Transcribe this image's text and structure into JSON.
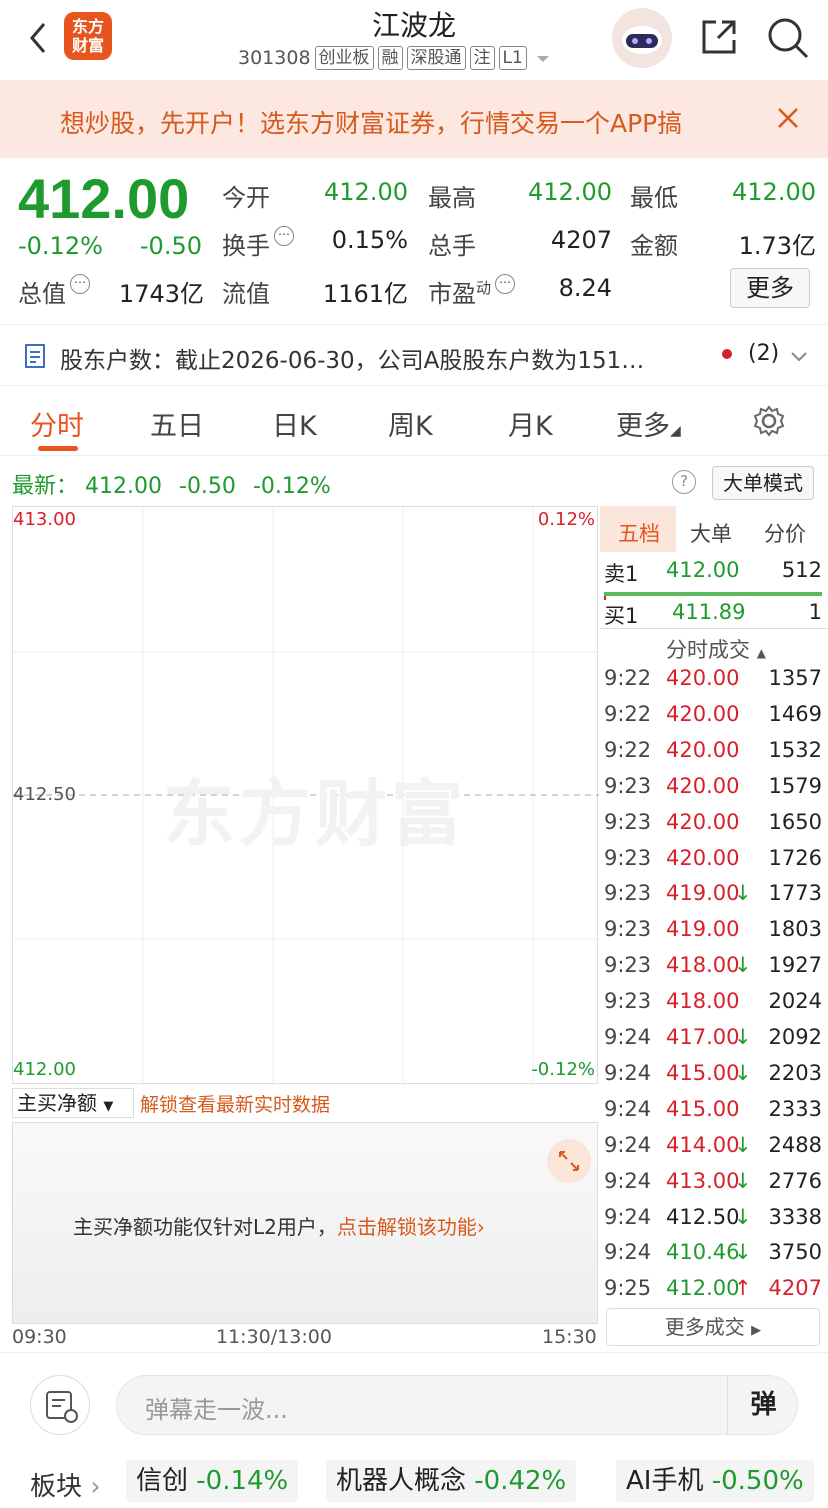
{
  "header": {
    "logo_line1": "东方",
    "logo_line2": "财富",
    "title": "江波龙",
    "code": "301308",
    "tags": [
      "创业板",
      "融",
      "深股通",
      "注",
      "L1"
    ]
  },
  "banner": {
    "text": "想炒股，先开户！选东方财富证券，行情交易一个APP搞"
  },
  "quote": {
    "price": "412.00",
    "change_pct": "-0.12%",
    "change": "-0.50",
    "open_label": "今开",
    "open": "412.00",
    "high_label": "最高",
    "high": "412.00",
    "low_label": "最低",
    "low": "412.00",
    "turnover_label": "换手",
    "turnover": "0.15%",
    "volume_label": "总手",
    "volume": "4207",
    "amount_label": "金额",
    "amount": "1.73亿",
    "mktcap_label": "总值",
    "mktcap": "1743亿",
    "float_label": "流值",
    "float": "1161亿",
    "pe_label": "市盈",
    "pe_sup": "动",
    "pe": "8.24",
    "more": "更多"
  },
  "notice": {
    "text": "股东户数：截止2026-06-30，公司A股股东户数为151…",
    "count": "(2)"
  },
  "tabs": [
    "分时",
    "五日",
    "日K",
    "周K",
    "月K",
    "更多"
  ],
  "latest": {
    "label": "最新：",
    "price": "412.00",
    "change": "-0.50",
    "pct": "-0.12%",
    "help": "?",
    "big_order_mode": "大单模式"
  },
  "chart": {
    "y_high": "413.00",
    "y_mid": "412.50",
    "y_low": "412.00",
    "pct_high": "0.12%",
    "pct_low": "-0.12%",
    "watermark": "东方财富",
    "time_start": "09:30",
    "time_mid": "11:30/13:00",
    "time_end": "15:30"
  },
  "orderbook": {
    "tabs": [
      "五档",
      "大单",
      "分价"
    ],
    "sell1": {
      "label": "卖1",
      "price": "412.00",
      "vol": "512"
    },
    "buy1": {
      "label": "买1",
      "price": "411.89",
      "vol": "1"
    },
    "trades_header": "分时成交",
    "trades": [
      {
        "t": "9:22",
        "p": "420.00",
        "v": "1357",
        "pc": "red",
        "vc": "black",
        "arrow": ""
      },
      {
        "t": "9:22",
        "p": "420.00",
        "v": "1469",
        "pc": "red",
        "vc": "black",
        "arrow": ""
      },
      {
        "t": "9:22",
        "p": "420.00",
        "v": "1532",
        "pc": "red",
        "vc": "black",
        "arrow": ""
      },
      {
        "t": "9:23",
        "p": "420.00",
        "v": "1579",
        "pc": "red",
        "vc": "black",
        "arrow": ""
      },
      {
        "t": "9:23",
        "p": "420.00",
        "v": "1650",
        "pc": "red",
        "vc": "black",
        "arrow": ""
      },
      {
        "t": "9:23",
        "p": "420.00",
        "v": "1726",
        "pc": "red",
        "vc": "black",
        "arrow": ""
      },
      {
        "t": "9:23",
        "p": "419.00",
        "v": "1773",
        "pc": "red",
        "vc": "black",
        "arrow": "down"
      },
      {
        "t": "9:23",
        "p": "419.00",
        "v": "1803",
        "pc": "red",
        "vc": "black",
        "arrow": ""
      },
      {
        "t": "9:23",
        "p": "418.00",
        "v": "1927",
        "pc": "red",
        "vc": "black",
        "arrow": "down"
      },
      {
        "t": "9:23",
        "p": "418.00",
        "v": "2024",
        "pc": "red",
        "vc": "black",
        "arrow": ""
      },
      {
        "t": "9:24",
        "p": "417.00",
        "v": "2092",
        "pc": "red",
        "vc": "black",
        "arrow": "down"
      },
      {
        "t": "9:24",
        "p": "415.00",
        "v": "2203",
        "pc": "red",
        "vc": "black",
        "arrow": "down"
      },
      {
        "t": "9:24",
        "p": "415.00",
        "v": "2333",
        "pc": "red",
        "vc": "black",
        "arrow": ""
      },
      {
        "t": "9:24",
        "p": "414.00",
        "v": "2488",
        "pc": "red",
        "vc": "black",
        "arrow": "down"
      },
      {
        "t": "9:24",
        "p": "413.00",
        "v": "2776",
        "pc": "red",
        "vc": "black",
        "arrow": "down"
      },
      {
        "t": "9:24",
        "p": "412.50",
        "v": "3338",
        "pc": "black",
        "vc": "black",
        "arrow": "down"
      },
      {
        "t": "9:24",
        "p": "410.46",
        "v": "3750",
        "pc": "green",
        "vc": "black",
        "arrow": "down"
      },
      {
        "t": "9:25",
        "p": "412.00",
        "v": "4207",
        "pc": "green",
        "vc": "red",
        "arrow": "up"
      }
    ],
    "more_trades": "更多成交"
  },
  "netbuy": {
    "selector": "主买净额",
    "unlock": "解锁查看最新实时数据",
    "message": "主买净额功能仅针对L2用户，",
    "message_link": "点击解锁该功能"
  },
  "comment": {
    "placeholder": "弹幕走一波...",
    "danmu": "弹"
  },
  "sectors": {
    "label": "板块",
    "items": [
      {
        "name": "信创",
        "pct": "-0.14%"
      },
      {
        "name": "机器人概念",
        "pct": "-0.42%"
      },
      {
        "name": "AI手机",
        "pct": "-0.50%"
      }
    ]
  },
  "colors": {
    "up": "#d8202a",
    "down": "#1f9a2e",
    "accent": "#e8541e"
  }
}
